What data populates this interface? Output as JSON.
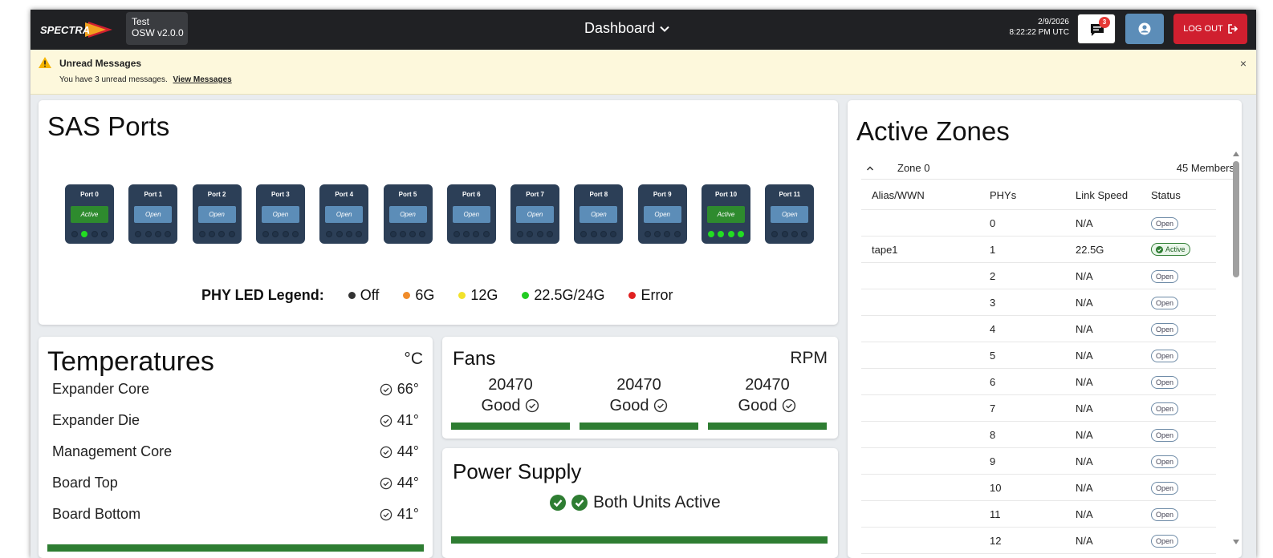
{
  "header": {
    "brand": "SPECTRA",
    "version_name": "Test",
    "version_number": "OSW v2.0.0",
    "title": "Dashboard",
    "date": "2/9/2026",
    "time": "8:22:22 PM UTC",
    "messages_count": "3",
    "logout_label": "LOG OUT"
  },
  "banner": {
    "title": "Unread Messages",
    "text": "You have 3 unread messages.",
    "link": "View Messages",
    "close": "×"
  },
  "sas": {
    "title": "SAS Ports",
    "ports": [
      {
        "label": "Port 0",
        "status": "Active",
        "leds": [
          false,
          true,
          false,
          false
        ]
      },
      {
        "label": "Port 1",
        "status": "Open",
        "leds": [
          false,
          false,
          false,
          false
        ]
      },
      {
        "label": "Port 2",
        "status": "Open",
        "leds": [
          false,
          false,
          false,
          false
        ]
      },
      {
        "label": "Port 3",
        "status": "Open",
        "leds": [
          false,
          false,
          false,
          false
        ]
      },
      {
        "label": "Port 4",
        "status": "Open",
        "leds": [
          false,
          false,
          false,
          false
        ]
      },
      {
        "label": "Port 5",
        "status": "Open",
        "leds": [
          false,
          false,
          false,
          false
        ]
      },
      {
        "label": "Port 6",
        "status": "Open",
        "leds": [
          false,
          false,
          false,
          false
        ]
      },
      {
        "label": "Port 7",
        "status": "Open",
        "leds": [
          false,
          false,
          false,
          false
        ]
      },
      {
        "label": "Port 8",
        "status": "Open",
        "leds": [
          false,
          false,
          false,
          false
        ]
      },
      {
        "label": "Port 9",
        "status": "Open",
        "leds": [
          false,
          false,
          false,
          false
        ]
      },
      {
        "label": "Port 10",
        "status": "Active",
        "leds": [
          true,
          true,
          true,
          true
        ]
      },
      {
        "label": "Port 11",
        "status": "Open",
        "leds": [
          false,
          false,
          false,
          false
        ]
      }
    ],
    "legend_title": "PHY LED Legend:",
    "legend": [
      {
        "label": "Off",
        "color": "#333333"
      },
      {
        "label": "6G",
        "color": "#f08c2a"
      },
      {
        "label": "12G",
        "color": "#f2e22a"
      },
      {
        "label": "22.5G/24G",
        "color": "#22cc22"
      },
      {
        "label": "Error",
        "color": "#e02020"
      }
    ]
  },
  "temperatures": {
    "title": "Temperatures",
    "unit": "°C",
    "rows": [
      {
        "name": "Expander Core",
        "value": "66°"
      },
      {
        "name": "Expander Die",
        "value": "41°"
      },
      {
        "name": "Management Core",
        "value": "44°"
      },
      {
        "name": "Board Top",
        "value": "44°"
      },
      {
        "name": "Board Bottom",
        "value": "41°"
      }
    ]
  },
  "fans": {
    "title": "Fans",
    "unit": "RPM",
    "items": [
      {
        "rpm": "20470",
        "status": "Good"
      },
      {
        "rpm": "20470",
        "status": "Good"
      },
      {
        "rpm": "20470",
        "status": "Good"
      }
    ]
  },
  "power": {
    "title": "Power Supply",
    "status": "Both Units Active"
  },
  "zones": {
    "title": "Active Zones",
    "zone_name": "Zone 0",
    "members": "45 Members",
    "headers": [
      "Alias/WWN",
      "PHYs",
      "Link Speed",
      "Status"
    ],
    "rows": [
      {
        "alias": "",
        "phy": "0",
        "speed": "N/A",
        "status": "Open"
      },
      {
        "alias": "tape1",
        "phy": "1",
        "speed": "22.5G",
        "status": "Active"
      },
      {
        "alias": "",
        "phy": "2",
        "speed": "N/A",
        "status": "Open"
      },
      {
        "alias": "",
        "phy": "3",
        "speed": "N/A",
        "status": "Open"
      },
      {
        "alias": "",
        "phy": "4",
        "speed": "N/A",
        "status": "Open"
      },
      {
        "alias": "",
        "phy": "5",
        "speed": "N/A",
        "status": "Open"
      },
      {
        "alias": "",
        "phy": "6",
        "speed": "N/A",
        "status": "Open"
      },
      {
        "alias": "",
        "phy": "7",
        "speed": "N/A",
        "status": "Open"
      },
      {
        "alias": "",
        "phy": "8",
        "speed": "N/A",
        "status": "Open"
      },
      {
        "alias": "",
        "phy": "9",
        "speed": "N/A",
        "status": "Open"
      },
      {
        "alias": "",
        "phy": "10",
        "speed": "N/A",
        "status": "Open"
      },
      {
        "alias": "",
        "phy": "11",
        "speed": "N/A",
        "status": "Open"
      },
      {
        "alias": "",
        "phy": "12",
        "speed": "N/A",
        "status": "Open"
      }
    ]
  }
}
